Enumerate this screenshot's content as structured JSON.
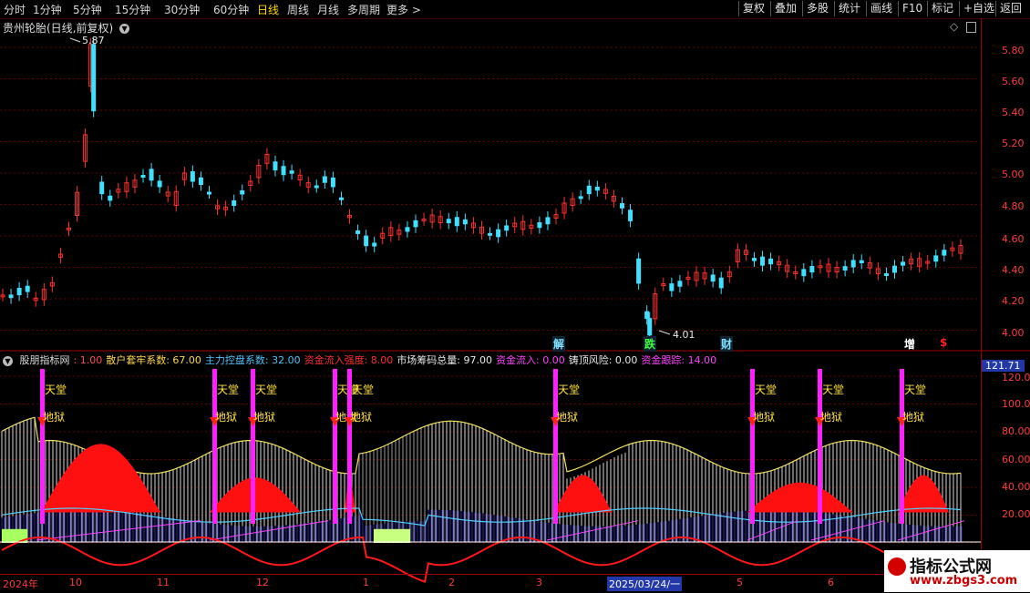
{
  "toolbar": {
    "periods": [
      "分时",
      "1分钟",
      "5分钟",
      "15分钟",
      "30分钟",
      "60分钟",
      "日线",
      "周线",
      "月线",
      "多周期",
      "更多 >"
    ],
    "active_period": "日线",
    "buttons": [
      "复权",
      "叠加",
      "多股",
      "统计",
      "画线",
      "F10",
      "标记",
      "+自选",
      "返回"
    ]
  },
  "price_panel": {
    "title": "贵州轮胎(日线,前复权)",
    "high_label": "5.87",
    "low_label": "4.01",
    "axis_labels": [
      "5.80",
      "5.60",
      "5.40",
      "5.20",
      "5.00",
      "4.80",
      "4.60",
      "4.40",
      "4.20",
      "4.00"
    ],
    "events": [
      {
        "text": "解",
        "color": "#7fe3ff"
      },
      {
        "text": "跌",
        "color": "#40ff40"
      },
      {
        "text": "财",
        "color": "#7fe3ff"
      },
      {
        "text": "增",
        "color": "#ffffff"
      },
      {
        "text": "$",
        "color": "#ff2020"
      }
    ]
  },
  "indicator_panel": {
    "title_parts": [
      {
        "text": "股朋指标网",
        "color": "#dcdcdc"
      },
      {
        "text": ": 1.00",
        "color": "#ff5050"
      },
      {
        "text": "散户套牢系数: 67.00",
        "color": "#ffd84a"
      },
      {
        "text": "主力控盘系数: 32.00",
        "color": "#4fc3ff"
      },
      {
        "text": "资金流入强度: 8.00",
        "color": "#ff3030"
      },
      {
        "text": "市场筹码总量: 97.00",
        "color": "#e8e8e8"
      },
      {
        "text": "资金流入: 0.00",
        "color": "#ff40ff"
      },
      {
        "text": "铸顶风险: 0.00",
        "color": "#e8e8e8"
      },
      {
        "text": "资金跟踪: 14.00",
        "color": "#ff40ff"
      }
    ],
    "axis_labels": [
      "121.71",
      "120.0",
      "100.0",
      "80.00",
      "60.00",
      "40.00",
      "20.00"
    ],
    "heaven_label": "天堂",
    "hell_label": "地狱"
  },
  "date_axis": [
    "2024年",
    "10",
    "11",
    "12",
    "1",
    "2",
    "3",
    "2025/03/24/一",
    "5",
    "6"
  ],
  "watermark": {
    "title": "指标公式网",
    "url": "www.zbgs3.com"
  },
  "colors": {
    "up": "#ff3030",
    "down": "#40e0ff",
    "axis": "#ff3b3b",
    "grid": "#6a0000"
  }
}
